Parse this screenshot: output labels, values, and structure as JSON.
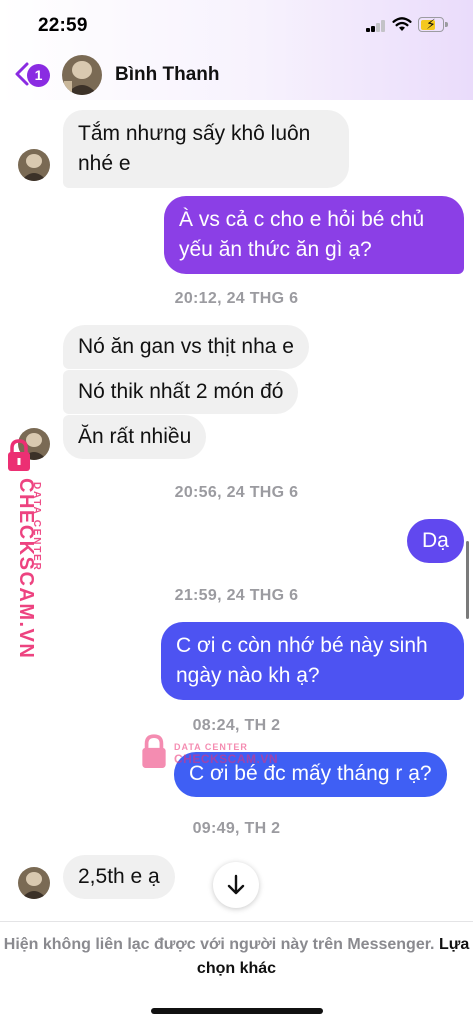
{
  "status_bar": {
    "time": "22:59"
  },
  "header": {
    "back_badge": "1",
    "contact_name": "Bình Thanh"
  },
  "messages": [
    {
      "dir": "in",
      "lines": [
        "Tắm nhưng sấy khô luôn",
        "nhé e"
      ]
    },
    {
      "dir": "out",
      "lines": [
        "À vs cả c cho e hỏi bé chủ",
        "yếu ăn thức ăn gì ạ?"
      ]
    },
    {
      "dir": "in",
      "lines": [
        "Nó ăn gan vs thịt nha e"
      ]
    },
    {
      "dir": "in",
      "lines": [
        "Nó thik nhất 2 món đó"
      ]
    },
    {
      "dir": "in",
      "lines": [
        "Ăn rất nhiều"
      ]
    },
    {
      "dir": "out",
      "lines": [
        "Dạ"
      ]
    },
    {
      "dir": "out",
      "lines": [
        "C ơi c còn nhớ bé này sinh",
        "ngày nào kh ạ?"
      ]
    },
    {
      "dir": "out",
      "lines": [
        "C ơi bé đc mấy tháng r ạ?"
      ]
    },
    {
      "dir": "in",
      "lines": [
        "2,5th e ạ"
      ]
    }
  ],
  "timestamps": [
    "20:12, 24 THG 6",
    "20:56, 24 THG 6",
    "21:59, 24 THG 6",
    "08:24, TH 2",
    "09:49, TH 2"
  ],
  "watermark": {
    "brand": "CHECKSCAM.VN",
    "sub": "DATA CENTER",
    "center_sub": "DATA CENTER",
    "center_brand": "CHECKSCAM.VN"
  },
  "footer": {
    "notice": "Hiện không liên lạc được với người này trên Messenger.",
    "option": "Lựa chọn khác"
  },
  "colors": {
    "accent": "#8a2be2",
    "incoming": "#f0f0f0",
    "watermark": "#ec2f73"
  }
}
